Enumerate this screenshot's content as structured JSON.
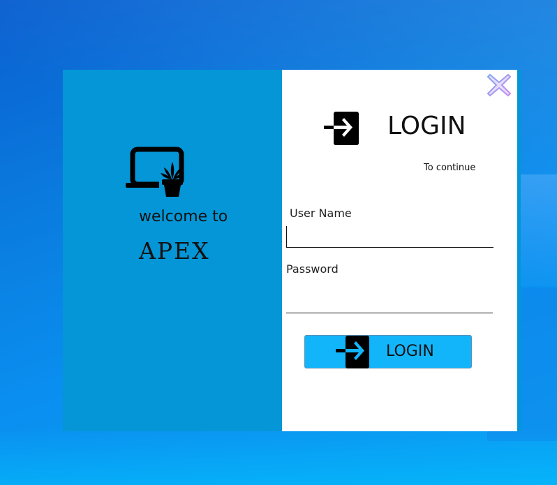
{
  "window": {
    "left_panel": {
      "welcome_text": "welcome to",
      "brand_name": "APEX",
      "icon": "laptop-plant-icon"
    },
    "header": {
      "title": "LOGIN",
      "subtitle": "To continue",
      "icon": "login-arrow-icon"
    },
    "form": {
      "username_label": "User Name",
      "username_value": "",
      "password_label": "Password",
      "password_value": ""
    },
    "login_button": {
      "label": "LOGIN",
      "icon": "login-arrow-icon"
    },
    "close_icon": "close-icon"
  },
  "colors": {
    "left_panel": "#0496d6",
    "button": "#13b5fa",
    "button_icon_arrow": "#13b5fa",
    "close_icon": "#b07ae8"
  }
}
